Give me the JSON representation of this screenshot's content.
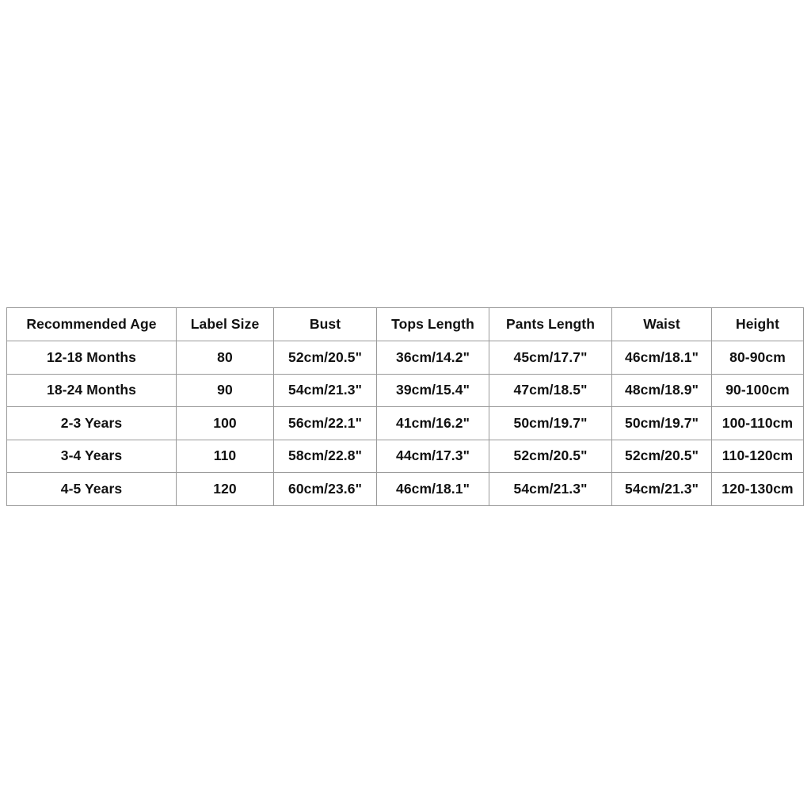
{
  "table": {
    "name": "size-chart",
    "columns": [
      "Recommended Age",
      "Label Size",
      "Bust",
      "Tops Length",
      "Pants Length",
      "Waist",
      "Height"
    ],
    "rows": [
      {
        "recommended_age": "12-18 Months",
        "label_size": "80",
        "bust": "52cm/20.5\"",
        "tops_length": "36cm/14.2\"",
        "pants_length": "45cm/17.7\"",
        "waist": "46cm/18.1\"",
        "height": "80-90cm"
      },
      {
        "recommended_age": "18-24 Months",
        "label_size": "90",
        "bust": "54cm/21.3\"",
        "tops_length": "39cm/15.4\"",
        "pants_length": "47cm/18.5\"",
        "waist": "48cm/18.9\"",
        "height": "90-100cm"
      },
      {
        "recommended_age": "2-3 Years",
        "label_size": "100",
        "bust": "56cm/22.1\"",
        "tops_length": "41cm/16.2\"",
        "pants_length": "50cm/19.7\"",
        "waist": "50cm/19.7\"",
        "height": "100-110cm"
      },
      {
        "recommended_age": "3-4 Years",
        "label_size": "110",
        "bust": "58cm/22.8\"",
        "tops_length": "44cm/17.3\"",
        "pants_length": "52cm/20.5\"",
        "waist": "52cm/20.5\"",
        "height": "110-120cm"
      },
      {
        "recommended_age": "4-5 Years",
        "label_size": "120",
        "bust": "60cm/23.6\"",
        "tops_length": "46cm/18.1\"",
        "pants_length": "54cm/21.3\"",
        "waist": "54cm/21.3\"",
        "height": "120-130cm"
      }
    ],
    "colors": {
      "border": "#9a9a9a",
      "text": "#111111",
      "background": "#ffffff"
    }
  }
}
